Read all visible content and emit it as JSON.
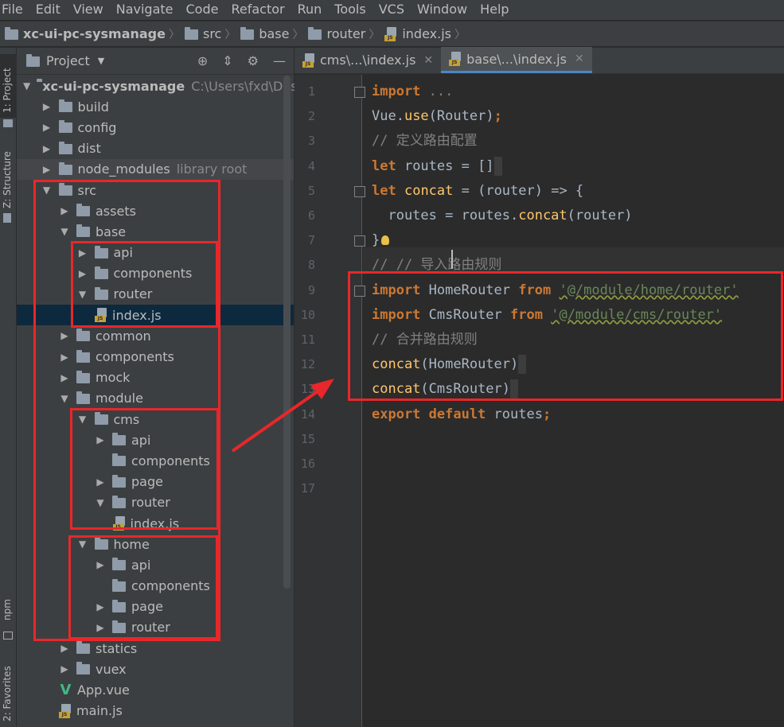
{
  "menu": [
    "File",
    "Edit",
    "View",
    "Navigate",
    "Code",
    "Refactor",
    "Run",
    "Tools",
    "VCS",
    "Window",
    "Help"
  ],
  "breadcrumb": {
    "items": [
      "xc-ui-pc-sysmanage",
      "src",
      "base",
      "router",
      "index.js"
    ]
  },
  "left_strip": {
    "project_tab": "1: Project",
    "structure_tab": "Z: Structure",
    "npm_tab": "npm",
    "favorites_tab": "2: Favorites"
  },
  "project_panel": {
    "title": "Project",
    "tree": [
      {
        "depth": 0,
        "type": "folder",
        "open": true,
        "label": "xc-ui-pc-sysmanage",
        "suffix": "C:\\Users\\fxd\\Deskto",
        "bold": true
      },
      {
        "depth": 1,
        "type": "folder",
        "open": false,
        "label": "build"
      },
      {
        "depth": 1,
        "type": "folder",
        "open": false,
        "label": "config"
      },
      {
        "depth": 1,
        "type": "folder",
        "open": false,
        "label": "dist"
      },
      {
        "depth": 1,
        "type": "folder",
        "open": false,
        "label": "node_modules",
        "suffix": "library root",
        "nm": true
      },
      {
        "depth": 1,
        "type": "folder",
        "open": true,
        "label": "src"
      },
      {
        "depth": 2,
        "type": "folder",
        "open": false,
        "label": "assets"
      },
      {
        "depth": 2,
        "type": "folder",
        "open": true,
        "label": "base"
      },
      {
        "depth": 3,
        "type": "folder",
        "open": false,
        "label": "api"
      },
      {
        "depth": 3,
        "type": "folder",
        "open": false,
        "label": "components"
      },
      {
        "depth": 3,
        "type": "folder",
        "open": true,
        "label": "router"
      },
      {
        "depth": 4,
        "type": "js",
        "label": "index.js",
        "selected": true
      },
      {
        "depth": 2,
        "type": "folder",
        "open": false,
        "label": "common"
      },
      {
        "depth": 2,
        "type": "folder",
        "open": false,
        "label": "components"
      },
      {
        "depth": 2,
        "type": "folder",
        "open": false,
        "label": "mock"
      },
      {
        "depth": 2,
        "type": "folder",
        "open": true,
        "label": "module"
      },
      {
        "depth": 3,
        "type": "folder",
        "open": true,
        "label": "cms"
      },
      {
        "depth": 4,
        "type": "folder",
        "open": false,
        "label": "api"
      },
      {
        "depth": 4,
        "type": "folder",
        "noarrow": true,
        "label": "components"
      },
      {
        "depth": 4,
        "type": "folder",
        "open": false,
        "label": "page"
      },
      {
        "depth": 4,
        "type": "folder",
        "open": true,
        "label": "router"
      },
      {
        "depth": 5,
        "type": "js",
        "label": "index.js"
      },
      {
        "depth": 3,
        "type": "folder",
        "open": true,
        "label": "home"
      },
      {
        "depth": 4,
        "type": "folder",
        "open": false,
        "label": "api"
      },
      {
        "depth": 4,
        "type": "folder",
        "noarrow": true,
        "label": "components"
      },
      {
        "depth": 4,
        "type": "folder",
        "open": false,
        "label": "page"
      },
      {
        "depth": 4,
        "type": "folder",
        "open": false,
        "label": "router"
      },
      {
        "depth": 2,
        "type": "folder",
        "open": false,
        "label": "statics"
      },
      {
        "depth": 2,
        "type": "folder",
        "open": false,
        "label": "vuex"
      },
      {
        "depth": 2,
        "type": "vue",
        "label": "App.vue"
      },
      {
        "depth": 2,
        "type": "js",
        "label": "main.js"
      }
    ]
  },
  "editor": {
    "tabs": [
      {
        "label": "cms\\...\\index.js",
        "active": false
      },
      {
        "label": "base\\...\\index.js",
        "active": true
      }
    ],
    "line_numbers": [
      "1",
      "2",
      "3",
      "4",
      "5",
      "6",
      "7",
      "8",
      "9",
      "10",
      "11",
      "12",
      "13",
      "14",
      "15",
      "16",
      "17"
    ],
    "lines": [
      [
        {
          "t": "kw",
          "v": "import"
        },
        {
          "t": "dim",
          "v": " ..."
        }
      ],
      [
        {
          "t": "",
          "v": "Vue."
        },
        {
          "t": "fn",
          "v": "use"
        },
        {
          "t": "",
          "v": "(Router)"
        },
        {
          "t": "kw",
          "v": ";"
        }
      ],
      [
        {
          "t": "cm",
          "v": "// 定义路由配置"
        }
      ],
      [
        {
          "t": "kw",
          "v": "let"
        },
        {
          "t": "",
          "v": " routes = []"
        }
      ],
      [
        {
          "t": "kw",
          "v": "let"
        },
        {
          "t": "",
          "v": " "
        },
        {
          "t": "fn",
          "v": "concat"
        },
        {
          "t": "",
          "v": " = (router) => {"
        }
      ],
      [
        {
          "t": "",
          "v": "  routes = routes."
        },
        {
          "t": "fn",
          "v": "concat"
        },
        {
          "t": "",
          "v": "(router)"
        }
      ],
      [
        {
          "t": "",
          "v": "}"
        }
      ],
      [
        {
          "t": "cm",
          "v": "// // 导入路由规则"
        }
      ],
      [
        {
          "t": "kw",
          "v": "import"
        },
        {
          "t": "",
          "v": " HomeRouter "
        },
        {
          "t": "kw",
          "v": "from"
        },
        {
          "t": "",
          "v": " "
        },
        {
          "t": "str",
          "v": "'@/module/home/router'"
        }
      ],
      [
        {
          "t": "kw",
          "v": "import"
        },
        {
          "t": "",
          "v": " CmsRouter "
        },
        {
          "t": "kw",
          "v": "from"
        },
        {
          "t": "",
          "v": " "
        },
        {
          "t": "str",
          "v": "'@/module/cms/router'"
        }
      ],
      [
        {
          "t": "cm",
          "v": "// 合并路由规则"
        }
      ],
      [
        {
          "t": "fn",
          "v": "concat"
        },
        {
          "t": "",
          "v": "(HomeRouter)"
        }
      ],
      [
        {
          "t": "fn",
          "v": "concat"
        },
        {
          "t": "",
          "v": "(CmsRouter)"
        }
      ],
      [
        {
          "t": "kw",
          "v": "export default"
        },
        {
          "t": "",
          "v": " routes"
        },
        {
          "t": "kw",
          "v": ";"
        }
      ],
      [],
      []
    ]
  },
  "colors": {
    "keyword": "#cc7832",
    "function": "#ffc66d",
    "string": "#6a8759",
    "comment": "#808080",
    "highlight_box": "#e8272a"
  }
}
